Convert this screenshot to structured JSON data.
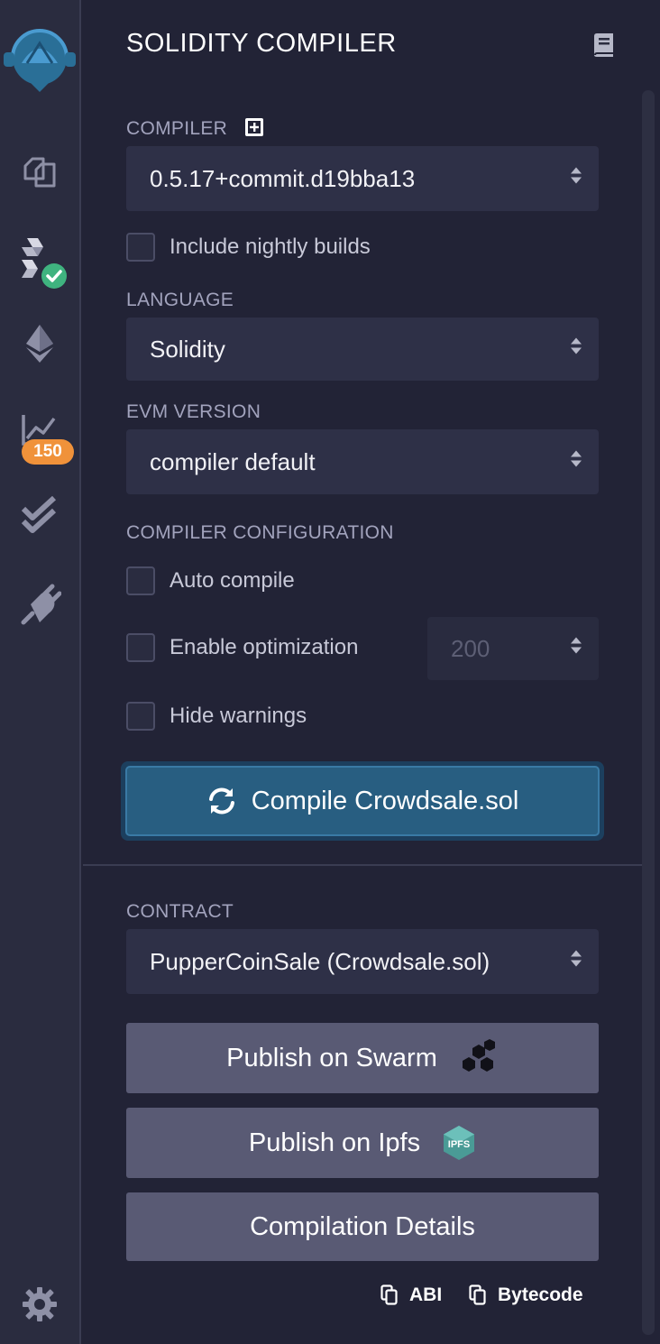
{
  "sidebar": {
    "icons": [
      "remix-logo-icon",
      "file-explorer-icon",
      "solidity-compiler-icon",
      "deploy-run-icon",
      "analysis-icon",
      "test-icon",
      "plugin-manager-icon",
      "settings-icon"
    ],
    "badge_count": "150",
    "accent_color": "#2a6f97",
    "badge_color": "#f0923a",
    "success_color": "#3fb37f"
  },
  "header": {
    "title": "SOLIDITY COMPILER"
  },
  "compiler": {
    "label": "COMPILER",
    "version": "0.5.17+commit.d19bba13",
    "nightly_label": "Include nightly builds",
    "nightly_checked": false
  },
  "language": {
    "label": "LANGUAGE",
    "value": "Solidity"
  },
  "evm": {
    "label": "EVM VERSION",
    "value": "compiler default"
  },
  "config": {
    "label": "COMPILER CONFIGURATION",
    "auto_compile_label": "Auto compile",
    "enable_optimization_label": "Enable optimization",
    "optimization_runs": "200",
    "hide_warnings_label": "Hide warnings"
  },
  "compile_button": {
    "label": "Compile Crowdsale.sol"
  },
  "contract": {
    "label": "CONTRACT",
    "value": "PupperCoinSale (Crowdsale.sol)"
  },
  "actions": {
    "publish_swarm": "Publish on Swarm",
    "publish_ipfs": "Publish on Ipfs",
    "ipfs_logo_text": "IPFS",
    "compilation_details": "Compilation Details",
    "abi": "ABI",
    "bytecode": "Bytecode"
  }
}
